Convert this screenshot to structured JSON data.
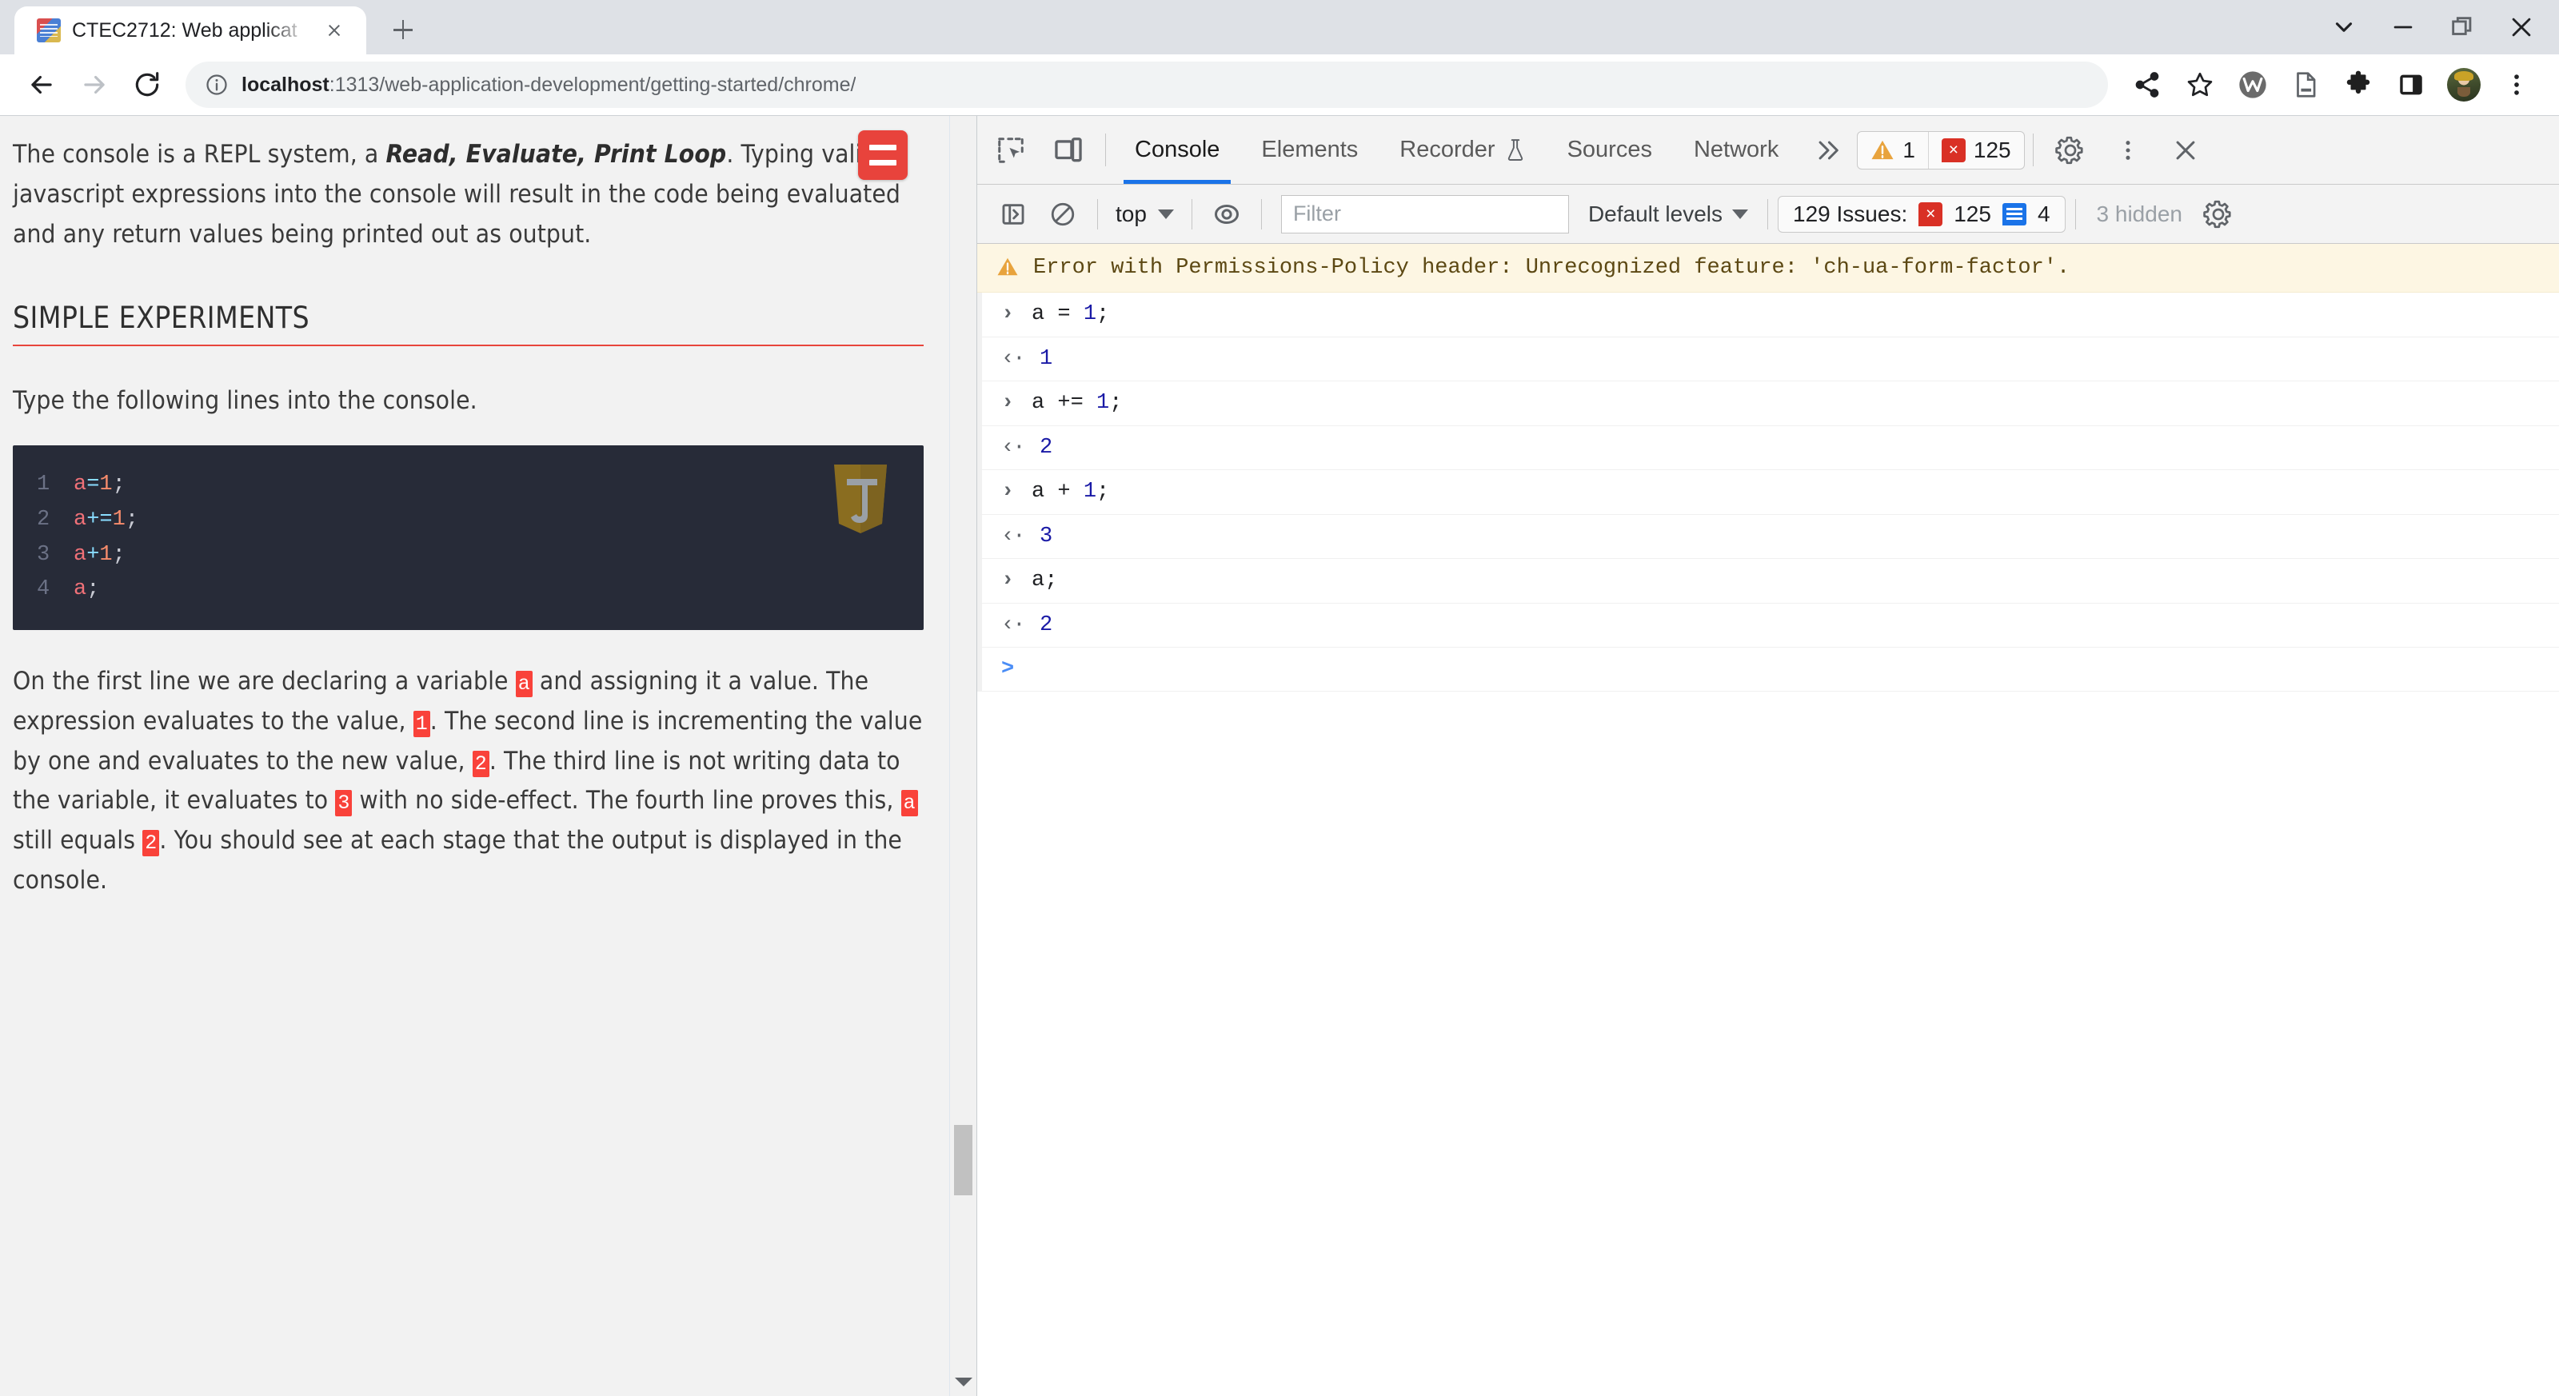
{
  "browser": {
    "tab": {
      "title": "CTEC2712: Web applicat",
      "favicon_name": "html5-document-favicon"
    },
    "newtab_label": "+",
    "window_controls": {
      "tab_search": "tab-search",
      "minimize": "minimize",
      "maximize": "restore",
      "close": "close"
    },
    "nav": {
      "back": "back",
      "forward": "forward",
      "reload": "reload"
    },
    "omnibox": {
      "host": "localhost",
      "path": ":1313/web-application-development/getting-started/chrome/",
      "site_info_icon": "info-circle-icon"
    },
    "actions": [
      "share-icon",
      "bookmark-star-icon",
      "wallabag-extension-icon",
      "reading-list-icon",
      "extensions-puzzle-icon",
      "side-panel-icon",
      "profile-avatar",
      "chrome-menu-icon"
    ]
  },
  "page": {
    "paragraph1_a": "The console is a REPL system, a ",
    "paragraph1_em": "Read, Evaluate, Print Loop",
    "paragraph1_b": ". Typing valid javascript expressions into the console will result in the code being evaluated and any return values being printed out as output.",
    "heading": "SIMPLE EXPERIMENTS",
    "paragraph2": "Type the following lines into the console.",
    "code_lines": [
      {
        "n": "1",
        "var": "a",
        "op": " = ",
        "num": "1",
        "pun": ";"
      },
      {
        "n": "2",
        "var": "a",
        "op": " += ",
        "num": "1",
        "pun": ";"
      },
      {
        "n": "3",
        "var": "a",
        "op": " + ",
        "num": "1",
        "pun": ";"
      },
      {
        "n": "4",
        "var": "a",
        "op": "",
        "num": "",
        "pun": ";"
      }
    ],
    "code_badge": "javascript-shield-badge",
    "menu_button": "hamburger-menu-button",
    "para3": {
      "s1": "On the first line we are declaring a variable ",
      "c1": "a",
      "s2": " and assigning it a value. The expression evaluates to the value, ",
      "c2": "1",
      "s3": ". The second line is incrementing the value by one and evaluates to the new value, ",
      "c3": "2",
      "s4": ". The third line is not writing data to the variable, it evaluates to ",
      "c4": "3",
      "s5": " with no side-effect. The fourth line proves this, ",
      "c5": "a",
      "s6": " still equals ",
      "c6": "2",
      "s7": ". You should see at each stage that the output is displayed in the console."
    }
  },
  "devtools": {
    "inspect_icon": "inspect-element-icon",
    "device_icon": "device-toolbar-icon",
    "tabs": [
      {
        "label": "Console",
        "active": true
      },
      {
        "label": "Elements",
        "active": false
      },
      {
        "label": "Recorder",
        "active": false,
        "icon": "experiment-flask-icon"
      },
      {
        "label": "Sources",
        "active": false
      },
      {
        "label": "Network",
        "active": false
      }
    ],
    "more_tabs_icon": "chevron-double-right-icon",
    "warning_count": "1",
    "error_count": "125",
    "settings_icon": "gear-icon",
    "more_icon": "kebab-menu-icon",
    "close_icon": "close-panel-icon",
    "filterbar": {
      "sidebar_icon": "console-sidebar-icon",
      "clear_icon": "clear-console-icon",
      "context": "top",
      "eye_icon": "live-expression-eye-icon",
      "filter_placeholder": "Filter",
      "levels": "Default levels",
      "issues_label": "129 Issues:",
      "issues_errors": "125",
      "issues_info": "4",
      "hidden": "3 hidden",
      "settings_icon": "console-settings-gear-icon"
    },
    "warning_message": "Error with Permissions-Policy header: Unrecognized feature: 'ch-ua-form-factor'.",
    "entries": [
      {
        "type": "input",
        "code": "a = ",
        "num": "1",
        "tail": ";"
      },
      {
        "type": "output",
        "value": "1"
      },
      {
        "type": "input",
        "code": "a += ",
        "num": "1",
        "tail": ";"
      },
      {
        "type": "output",
        "value": "2"
      },
      {
        "type": "input",
        "code": "a + ",
        "num": "1",
        "tail": ";"
      },
      {
        "type": "output",
        "value": "3"
      },
      {
        "type": "input",
        "code": "a;",
        "num": "",
        "tail": ""
      },
      {
        "type": "output",
        "value": "2"
      }
    ],
    "prompt_chevron": ">"
  },
  "colors": {
    "accent_blue": "#1a73e8",
    "error_red": "#d93025",
    "warn_orange": "#e8a33d",
    "brand_red": "#e8433c",
    "inline_code_red": "#f9423a",
    "code_bg": "#272b38"
  }
}
